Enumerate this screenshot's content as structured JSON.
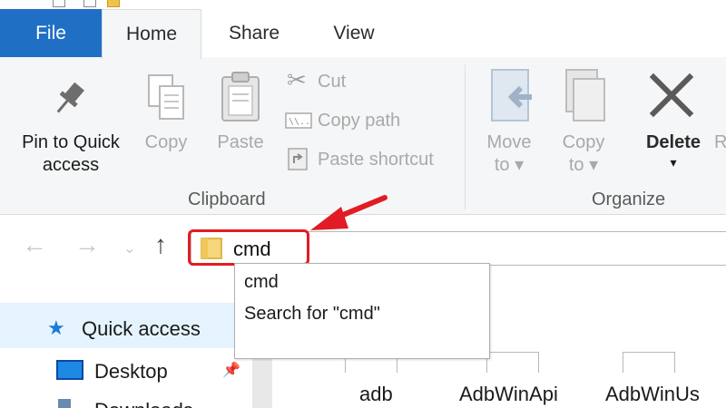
{
  "tabs": [
    {
      "label": "File",
      "active": false
    },
    {
      "label": "Home",
      "active": true
    },
    {
      "label": "Share",
      "active": false
    },
    {
      "label": "View",
      "active": false
    }
  ],
  "ribbon": {
    "pin": {
      "line1": "Pin to Quick",
      "line2": "access"
    },
    "copy": "Copy",
    "paste": "Paste",
    "cut": "Cut",
    "copy_path": "Copy path",
    "paste_shortcut": "Paste shortcut",
    "clipboard_label": "Clipboard",
    "move_to": {
      "line1": "Move",
      "line2": "to ▾"
    },
    "copy_to": {
      "line1": "Copy",
      "line2": "to ▾"
    },
    "delete": {
      "line1": "Delete",
      "line2": "▾"
    },
    "rename_partial": "R",
    "organize_label": "Organize"
  },
  "address": {
    "value": "cmd",
    "suggestions": [
      "cmd",
      "Search for \"cmd\""
    ]
  },
  "nav_pane": {
    "quick_access": "Quick access",
    "desktop": "Desktop"
  },
  "files": [
    "adb",
    "AdbWinApi",
    "AdbWinUs"
  ],
  "colors": {
    "file_tab": "#1f6fc5",
    "highlight": "#e11c24",
    "selected_nav": "#e5f3ff"
  }
}
